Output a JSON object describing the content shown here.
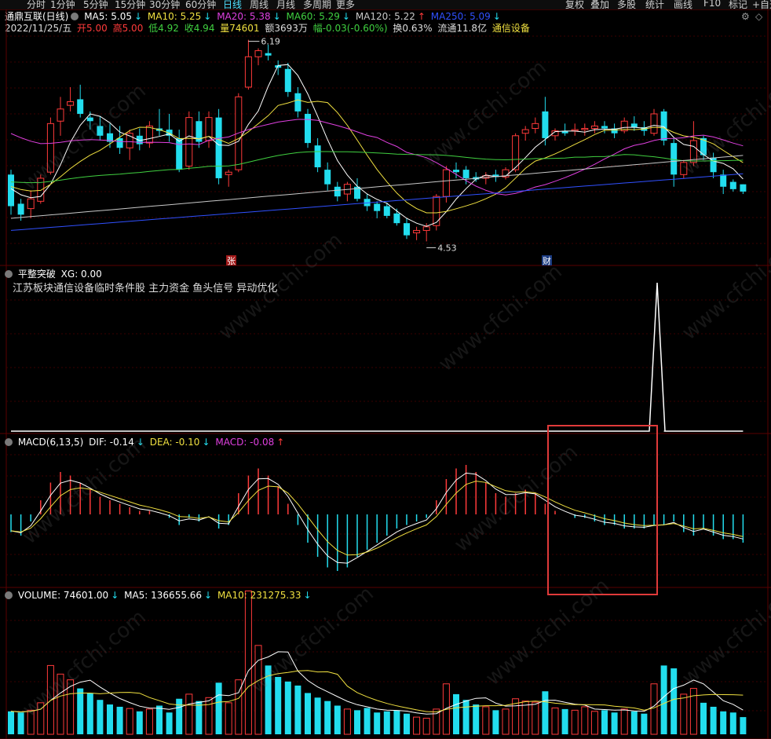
{
  "toolbar": {
    "left": [
      "分时",
      "1分钟",
      "5分钟",
      "15分钟",
      "30分钟",
      "60分钟",
      "日线",
      "周线",
      "月线",
      "多周期",
      "更多"
    ],
    "active": "日线",
    "right": [
      "复权",
      "叠加",
      "多股",
      "统计",
      "画线",
      "F10",
      "标记",
      "+自选"
    ]
  },
  "stock": {
    "name": "通鼎互联(日线)",
    "ma5": "MA5: 5.05",
    "ma10": "MA10: 5.25",
    "ma20": "MA20: 5.38",
    "ma60": "MA60: 5.29",
    "ma120": "MA120: 5.22",
    "ma250": "MA250: 5.09",
    "date": "2022/11/25/五",
    "open": "开5.00",
    "high": "高5.00",
    "low": "低4.92",
    "close": "收4.94",
    "vol": "量74601",
    "amount": "额3693万",
    "change": "幅-0.03(-0.60%)",
    "turnover": "换0.63%",
    "float": "流通11.8亿",
    "industry": "通信设备",
    "max_label": "6.19",
    "min_label": "4.53",
    "zhang_tag": "张",
    "cai_tag": "财"
  },
  "colors": {
    "up": "#ff3a3a",
    "down": "#22ddee",
    "ma5": "#ffffff",
    "ma10": "#f0e040",
    "ma20": "#e040e0",
    "ma60": "#40d040",
    "ma120": "#c8c8c8",
    "ma250": "#3050ff",
    "box": "#e03a3a"
  },
  "indicator": {
    "title": "平整突破",
    "xg": "XG: 0.00",
    "note": "江苏板块通信设备临时条件股 主力资金 鱼头信号 异动优化"
  },
  "macd": {
    "title": "MACD(6,13,5)",
    "dif": "DIF: -0.14",
    "dea": "DEA: -0.10",
    "macd": "MACD: -0.08"
  },
  "volume": {
    "title": "VOLUME: 74601.00",
    "ma5": "MA5: 136655.66",
    "ma10": "MA10: 231275.33"
  },
  "watermark": "www.cfchi.com",
  "kline": [
    [
      5.08,
      5.12,
      4.75,
      4.82
    ],
    [
      4.84,
      4.88,
      4.7,
      4.75
    ],
    [
      4.8,
      4.95,
      4.72,
      4.88
    ],
    [
      4.86,
      5.08,
      4.84,
      5.05
    ],
    [
      5.1,
      5.55,
      5.08,
      5.5
    ],
    [
      5.52,
      5.72,
      5.4,
      5.62
    ],
    [
      5.65,
      5.8,
      5.6,
      5.68
    ],
    [
      5.7,
      5.82,
      5.55,
      5.58
    ],
    [
      5.55,
      5.6,
      5.45,
      5.52
    ],
    [
      5.48,
      5.56,
      5.36,
      5.4
    ],
    [
      5.42,
      5.5,
      5.3,
      5.35
    ],
    [
      5.38,
      5.48,
      5.25,
      5.3
    ],
    [
      5.3,
      5.45,
      5.2,
      5.42
    ],
    [
      5.4,
      5.46,
      5.28,
      5.33
    ],
    [
      5.34,
      5.52,
      5.3,
      5.48
    ],
    [
      5.46,
      5.62,
      5.4,
      5.44
    ],
    [
      5.45,
      5.58,
      5.35,
      5.4
    ],
    [
      5.38,
      5.45,
      5.1,
      5.12
    ],
    [
      5.15,
      5.6,
      5.12,
      5.55
    ],
    [
      5.52,
      5.6,
      5.3,
      5.35
    ],
    [
      5.36,
      5.6,
      5.3,
      5.55
    ],
    [
      5.55,
      5.62,
      5.0,
      5.05
    ],
    [
      5.08,
      5.12,
      4.98,
      5.1
    ],
    [
      5.12,
      5.75,
      5.1,
      5.72
    ],
    [
      5.8,
      6.19,
      5.78,
      6.05
    ],
    [
      6.05,
      6.12,
      5.98,
      6.1
    ],
    [
      6.08,
      6.15,
      6.02,
      6.06
    ],
    [
      5.98,
      6.02,
      5.9,
      5.96
    ],
    [
      5.95,
      6.0,
      5.72,
      5.76
    ],
    [
      5.75,
      5.8,
      5.55,
      5.6
    ],
    [
      5.58,
      5.62,
      5.3,
      5.34
    ],
    [
      5.32,
      5.38,
      5.1,
      5.14
    ],
    [
      5.12,
      5.18,
      4.95,
      5.0
    ],
    [
      4.98,
      5.02,
      4.86,
      4.9
    ],
    [
      4.92,
      5.02,
      4.86,
      5.0
    ],
    [
      4.98,
      5.05,
      4.86,
      4.88
    ],
    [
      4.88,
      4.92,
      4.78,
      4.82
    ],
    [
      4.84,
      4.86,
      4.72,
      4.78
    ],
    [
      4.82,
      4.85,
      4.72,
      4.74
    ],
    [
      4.76,
      4.8,
      4.66,
      4.68
    ],
    [
      4.68,
      4.72,
      4.55,
      4.58
    ],
    [
      4.6,
      4.65,
      4.54,
      4.62
    ],
    [
      4.62,
      4.68,
      4.53,
      4.65
    ],
    [
      4.66,
      4.92,
      4.62,
      4.9
    ],
    [
      4.9,
      5.15,
      4.85,
      5.12
    ],
    [
      5.12,
      5.18,
      5.05,
      5.1
    ],
    [
      5.12,
      5.15,
      5.0,
      5.05
    ],
    [
      5.06,
      5.1,
      5.02,
      5.04
    ],
    [
      5.05,
      5.1,
      5.0,
      5.07
    ],
    [
      5.08,
      5.12,
      5.02,
      5.06
    ],
    [
      5.06,
      5.14,
      5.04,
      5.12
    ],
    [
      5.12,
      5.42,
      5.1,
      5.4
    ],
    [
      5.42,
      5.48,
      5.36,
      5.45
    ],
    [
      5.46,
      5.55,
      5.42,
      5.5
    ],
    [
      5.6,
      5.72,
      5.32,
      5.38
    ],
    [
      5.4,
      5.46,
      5.36,
      5.44
    ],
    [
      5.44,
      5.5,
      5.4,
      5.42
    ],
    [
      5.44,
      5.5,
      5.4,
      5.45
    ],
    [
      5.45,
      5.5,
      5.4,
      5.46
    ],
    [
      5.46,
      5.52,
      5.42,
      5.48
    ],
    [
      5.48,
      5.52,
      5.42,
      5.46
    ],
    [
      5.46,
      5.5,
      5.38,
      5.42
    ],
    [
      5.44,
      5.55,
      5.42,
      5.52
    ],
    [
      5.5,
      5.56,
      5.44,
      5.47
    ],
    [
      5.47,
      5.52,
      5.4,
      5.44
    ],
    [
      5.42,
      5.62,
      5.4,
      5.58
    ],
    [
      5.6,
      5.62,
      5.32,
      5.36
    ],
    [
      5.34,
      5.38,
      4.98,
      5.08
    ],
    [
      5.08,
      5.2,
      5.05,
      5.18
    ],
    [
      5.18,
      5.52,
      5.15,
      5.36
    ],
    [
      5.38,
      5.4,
      5.2,
      5.24
    ],
    [
      5.22,
      5.26,
      5.05,
      5.1
    ],
    [
      5.08,
      5.12,
      4.92,
      4.98
    ],
    [
      5.02,
      5.04,
      4.94,
      4.96
    ],
    [
      5.0,
      5.0,
      4.92,
      4.94
    ]
  ],
  "macd_hist": [
    -0.05,
    -0.06,
    -0.02,
    0.04,
    0.09,
    0.12,
    0.11,
    0.09,
    0.07,
    0.05,
    0.04,
    0.03,
    0.02,
    0.01,
    0.01,
    0.0,
    -0.01,
    -0.03,
    -0.01,
    -0.02,
    0.0,
    -0.04,
    -0.03,
    0.06,
    0.11,
    0.13,
    0.11,
    0.08,
    0.03,
    -0.03,
    -0.08,
    -0.12,
    -0.15,
    -0.16,
    -0.15,
    -0.12,
    -0.1,
    -0.08,
    -0.06,
    -0.04,
    -0.03,
    -0.02,
    -0.01,
    0.04,
    0.1,
    0.13,
    0.14,
    0.12,
    0.09,
    0.06,
    0.05,
    0.06,
    0.07,
    0.06,
    0.03,
    0.01,
    0.0,
    -0.01,
    -0.01,
    -0.02,
    -0.03,
    -0.03,
    -0.04,
    -0.04,
    -0.04,
    -0.03,
    -0.03,
    -0.02,
    -0.05,
    -0.06,
    -0.04,
    -0.06,
    -0.07,
    -0.07,
    -0.08
  ],
  "vol_bars": [
    40,
    38,
    42,
    55,
    120,
    105,
    95,
    80,
    72,
    60,
    52,
    48,
    45,
    40,
    44,
    50,
    38,
    62,
    70,
    58,
    64,
    90,
    55,
    95,
    250,
    155,
    120,
    100,
    92,
    85,
    72,
    64,
    58,
    50,
    44,
    42,
    46,
    38,
    40,
    42,
    36,
    30,
    28,
    44,
    88,
    70,
    60,
    52,
    48,
    42,
    44,
    62,
    58,
    56,
    75,
    46,
    44,
    42,
    48,
    40,
    42,
    38,
    44,
    40,
    36,
    88,
    120,
    115,
    70,
    80,
    55,
    48,
    40,
    38,
    30
  ]
}
